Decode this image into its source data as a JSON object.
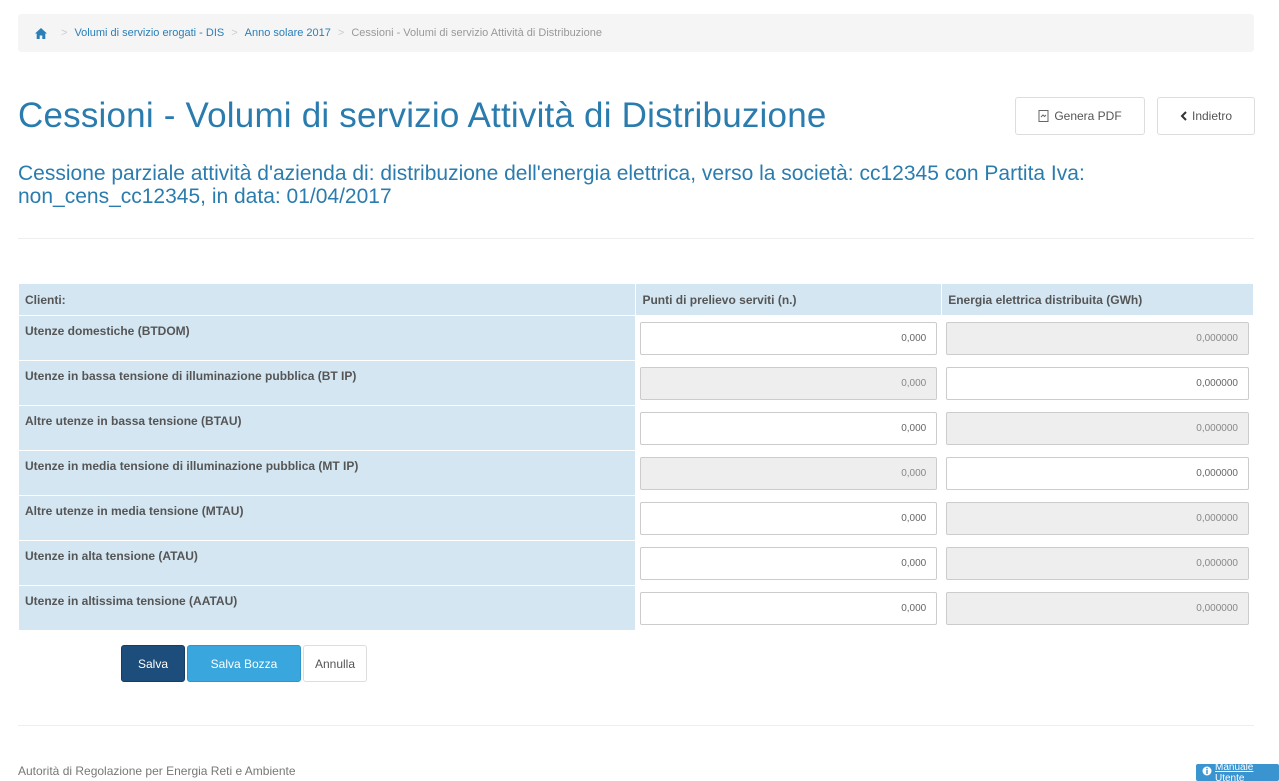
{
  "breadcrumb": {
    "items": [
      "Volumi di servizio erogati - DIS",
      "Anno solare 2017"
    ],
    "current": "Cessioni - Volumi di servizio Attività di Distribuzione"
  },
  "header": {
    "title": "Cessioni - Volumi di servizio Attività  di Distribuzione",
    "pdf_button": "Genera PDF",
    "back_button": "Indietro"
  },
  "subtitle": "Cessione parziale attività d'azienda di: distribuzione dell'energia elettrica, verso la società: cc12345 con Partita Iva: non_cens_cc12345, in data: 01/04/2017",
  "table": {
    "headers": [
      "Clienti:",
      "Punti di prelievo serviti (n.)",
      "Energia elettrica distribuita (GWh)"
    ],
    "rows": [
      {
        "label": "Utenze domestiche (BTDOM)",
        "punti": "0,000",
        "energia": "0,000000"
      },
      {
        "label": "Utenze in bassa tensione di illuminazione pubblica (BT IP)",
        "punti": "0,000",
        "energia": "0,000000"
      },
      {
        "label": "Altre utenze in bassa tensione (BTAU)",
        "punti": "0,000",
        "energia": "0,000000"
      },
      {
        "label": "Utenze in media tensione di illuminazione pubblica (MT IP)",
        "punti": "0,000",
        "energia": "0,000000"
      },
      {
        "label": "Altre utenze in media tensione (MTAU)",
        "punti": "0,000",
        "energia": "0,000000"
      },
      {
        "label": "Utenze in alta tensione (ATAU)",
        "punti": "0,000",
        "energia": "0,000000"
      },
      {
        "label": "Utenze in altissima tensione (AATAU)",
        "punti": "0,000",
        "energia": "0,000000"
      }
    ]
  },
  "actions": {
    "save": "Salva",
    "save_draft": "Salva Bozza",
    "cancel": "Annulla"
  },
  "footer": {
    "text": "Autorità di Regolazione per Energia Reti e Ambiente",
    "manual": "Manuale Utente"
  }
}
